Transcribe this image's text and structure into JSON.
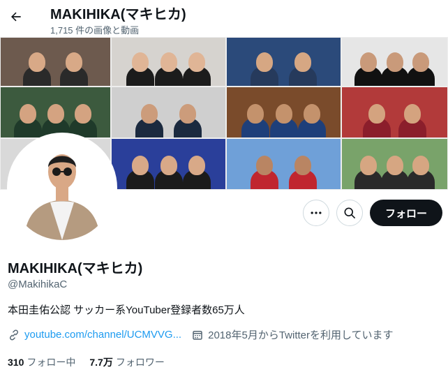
{
  "header": {
    "title": "MAKIHIKA(マキヒカ)",
    "subtitle": "1,715 件の画像と動画"
  },
  "banner": {
    "tiles": [
      {
        "bg": "#6d5a4e",
        "skin": "#d8a987",
        "shirt": "#2a2a2a"
      },
      {
        "bg": "#d6d3cf",
        "skin": "#e0b596",
        "shirt": "#1c1c1c"
      },
      {
        "bg": "#2b4a7a",
        "skin": "#d6a783",
        "shirt": "#263a5c"
      },
      {
        "bg": "#e6e6e6",
        "skin": "#c99a7a",
        "shirt": "#111111"
      },
      {
        "bg": "#3c5a3e",
        "skin": "#d4a381",
        "shirt": "#1f3a2a"
      },
      {
        "bg": "#cfcfcf",
        "skin": "#cc9c7b",
        "shirt": "#1b2a3f"
      },
      {
        "bg": "#7a4b2b",
        "skin": "#c4926c",
        "shirt": "#1e3f7a"
      },
      {
        "bg": "#b23a3a",
        "skin": "#d4a37f",
        "shirt": "#8b1e2b"
      },
      {
        "bg": "#d9d9d9",
        "skin": "#d2a180",
        "shirt": "#b11b2a"
      },
      {
        "bg": "#2a3f9a",
        "skin": "#d8a988",
        "shirt": "#1b1b1b"
      },
      {
        "bg": "#6fa0d8",
        "skin": "#b98563",
        "shirt": "#c0262f"
      },
      {
        "bg": "#79a36a",
        "skin": "#d6a682",
        "shirt": "#2a2a2a"
      }
    ]
  },
  "avatar": {
    "skin": "#d9a886",
    "jacket": "#b59b80",
    "shirt": "#f3f3f3"
  },
  "actions": {
    "follow_label": "フォロー"
  },
  "profile": {
    "name": "MAKIHIKA(マキヒカ)",
    "handle": "@MakihikaC",
    "bio": "本田圭佑公認 サッカー系YouTuber登録者数65万人",
    "link_text": "youtube.com/channel/UCMVVG...",
    "joined": "2018年5月からTwitterを利用しています"
  },
  "stats": {
    "following_count": "310",
    "following_label": "フォロー中",
    "followers_count": "7.7万",
    "followers_label": "フォロワー"
  },
  "colors": {
    "accent": "#1d9bf0",
    "text": "#0f1419",
    "secondary": "#536471",
    "follow_bg": "#0f1419"
  }
}
